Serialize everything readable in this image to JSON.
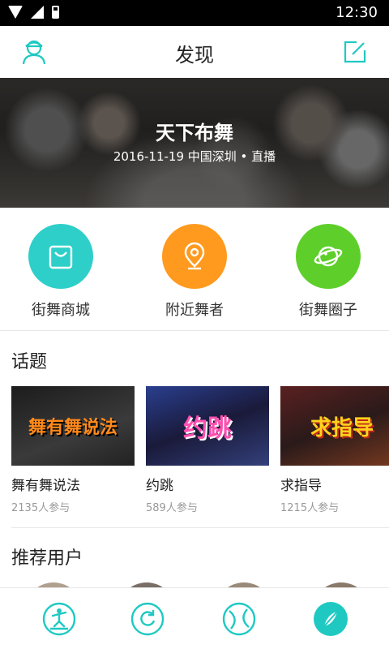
{
  "status_bar": {
    "time": "12:30"
  },
  "header": {
    "title": "发现"
  },
  "banner": {
    "title": "天下布舞",
    "subtitle": "2016-11-19  中国深圳 • 直播"
  },
  "entries": [
    {
      "label": "街舞商城",
      "icon": "shopping-bag-icon",
      "color": "#2ecfc9"
    },
    {
      "label": "附近舞者",
      "icon": "location-pin-icon",
      "color": "#ff9a1e"
    },
    {
      "label": "街舞圈子",
      "icon": "planet-icon",
      "color": "#5ecf2a"
    }
  ],
  "topics_section": {
    "title": "话题"
  },
  "topics": [
    {
      "name": "舞有舞说法",
      "count": "2135人参与",
      "thumb_text": "舞有舞说法"
    },
    {
      "name": "约跳",
      "count": "589人参与",
      "thumb_text": "约跳"
    },
    {
      "name": "求指导",
      "count": "1215人参与",
      "thumb_text": "求指导"
    }
  ],
  "recommend_section": {
    "title": "推荐用户"
  },
  "tabbar": {
    "items": [
      {
        "icon": "dancer-icon",
        "active": false
      },
      {
        "icon": "refresh-circle-icon",
        "active": false
      },
      {
        "icon": "ball-icon",
        "active": false
      },
      {
        "icon": "discover-compass-icon",
        "active": true
      }
    ]
  },
  "colors": {
    "accent": "#1fc9c2"
  }
}
